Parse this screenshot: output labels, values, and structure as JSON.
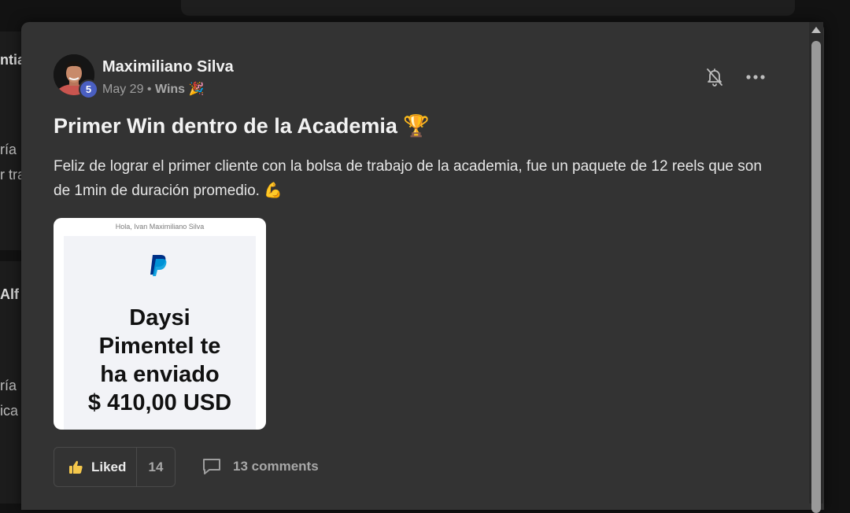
{
  "background": {
    "feed_fragments": [
      "ntia",
      "ría",
      "r tra",
      "Alf",
      "ría",
      "ica"
    ]
  },
  "post": {
    "author": {
      "name": "Maximiliano Silva",
      "level": "5"
    },
    "meta": {
      "date": "May 29",
      "separator": "•",
      "category": "Wins",
      "category_emoji": "🎉"
    },
    "title": "Primer Win dentro de la Academia",
    "title_emoji": "🏆",
    "body": "Feliz de lograr el primer cliente con la bolsa de trabajo de la academia, fue un paquete de 12 reels que son de 1min de duración promedio.",
    "body_emoji": "💪",
    "attachment": {
      "greeting": "Hola, Ivan Maximiliano Silva",
      "logo_icon": "paypal-logo",
      "message_lines": [
        "Daysi",
        "Pimentel te",
        "ha enviado",
        "$ 410,00 USD"
      ]
    },
    "actions": {
      "like_label": "Liked",
      "like_count": "14",
      "comments_label": "13 comments"
    },
    "icons": {
      "notifications": "bell-off-icon",
      "more": "more-horizontal-icon",
      "like": "thumbs-up-icon",
      "comments": "comment-icon"
    }
  },
  "colors": {
    "modal_bg": "#333333",
    "page_bg": "#121212",
    "level_badge": "#4a5fc1",
    "like_icon": "#f5c84c",
    "paypal_dark": "#003087",
    "paypal_light": "#009cde"
  }
}
